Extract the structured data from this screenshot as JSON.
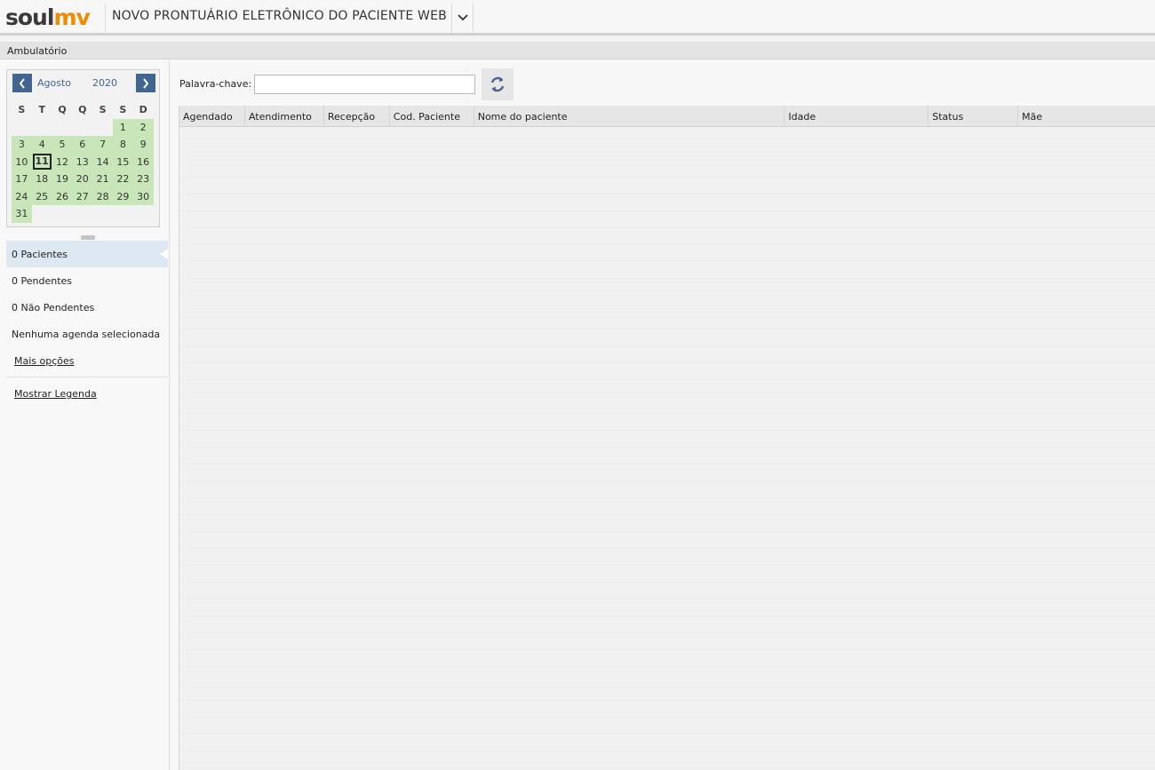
{
  "header": {
    "logo_soul": "soul",
    "logo_mv": "mv",
    "title": "NOVO PRONTUÁRIO ELETRÔNICO DO PACIENTE WEB"
  },
  "breadcrumb": "Ambulatório",
  "calendar": {
    "month": "Agosto",
    "year": "2020",
    "weekdays": [
      "S",
      "T",
      "Q",
      "Q",
      "S",
      "S",
      "D"
    ],
    "weeks": [
      [
        "",
        "",
        "",
        "",
        "",
        "1",
        "2"
      ],
      [
        "3",
        "4",
        "5",
        "6",
        "7",
        "8",
        "9"
      ],
      [
        "10",
        "11",
        "12",
        "13",
        "14",
        "15",
        "16"
      ],
      [
        "17",
        "18",
        "19",
        "20",
        "21",
        "22",
        "23"
      ],
      [
        "24",
        "25",
        "26",
        "27",
        "28",
        "29",
        "30"
      ],
      [
        "31",
        "",
        "",
        "",
        "",
        "",
        ""
      ]
    ],
    "today": "11"
  },
  "sidebar": {
    "items": [
      {
        "label": "0 Pacientes",
        "active": true
      },
      {
        "label": "0 Pendentes",
        "active": false
      },
      {
        "label": "0 Não Pendentes",
        "active": false
      },
      {
        "label": "Nenhuma agenda selecionada",
        "active": false
      }
    ],
    "more_options": "Mais opções",
    "show_legend": "Mostrar Legenda"
  },
  "search": {
    "label": "Palavra-chave:",
    "value": "",
    "placeholder": ""
  },
  "table": {
    "columns": [
      "Agendado",
      "Atendimento",
      "Recepção",
      "Cod. Paciente",
      "Nome do paciente",
      "Idade",
      "Status",
      "Mãe"
    ],
    "rows": []
  },
  "colors": {
    "accent": "#3f6590",
    "calendar_day_bg": "#c9e6b8",
    "logo_orange": "#f08a00",
    "active_item_bg": "#dde8f3"
  },
  "icons": {
    "prev": "chevron-left-icon",
    "next": "chevron-right-icon",
    "dropdown": "chevron-down-icon",
    "refresh": "refresh-icon"
  }
}
